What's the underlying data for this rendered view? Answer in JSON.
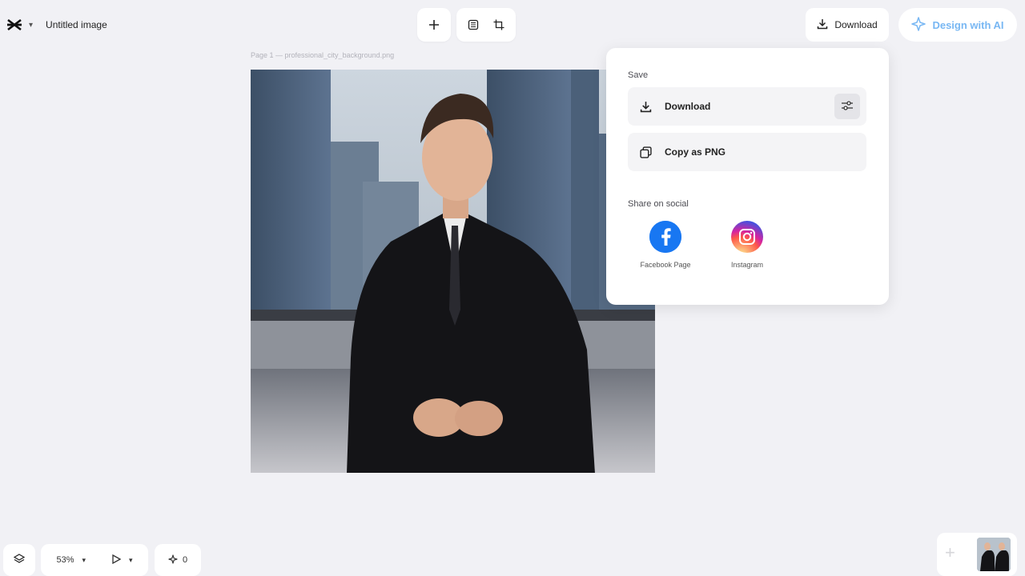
{
  "header": {
    "app_logo": "capcut-logo-icon",
    "document_title": "Untitled image",
    "download_label": "Download",
    "ai_button_label": "Design with AI"
  },
  "toolbar": {
    "add_icon": "plus-icon",
    "resize_icon": "frame-icon",
    "crop_icon": "crop-icon"
  },
  "canvas": {
    "page_label": "Page 1 — professional_city_background.png"
  },
  "save_panel": {
    "save_title": "Save",
    "download_label": "Download",
    "copy_label": "Copy as PNG",
    "share_title": "Share on social",
    "social": [
      {
        "label": "Facebook Page",
        "icon": "facebook-icon"
      },
      {
        "label": "Instagram",
        "icon": "instagram-icon"
      }
    ]
  },
  "bottom_bar": {
    "zoom": "53%",
    "magic_count": "0"
  },
  "colors": {
    "background": "#f1f1f5",
    "ai_accent": "#78b7f3",
    "facebook": "#1877f2"
  }
}
